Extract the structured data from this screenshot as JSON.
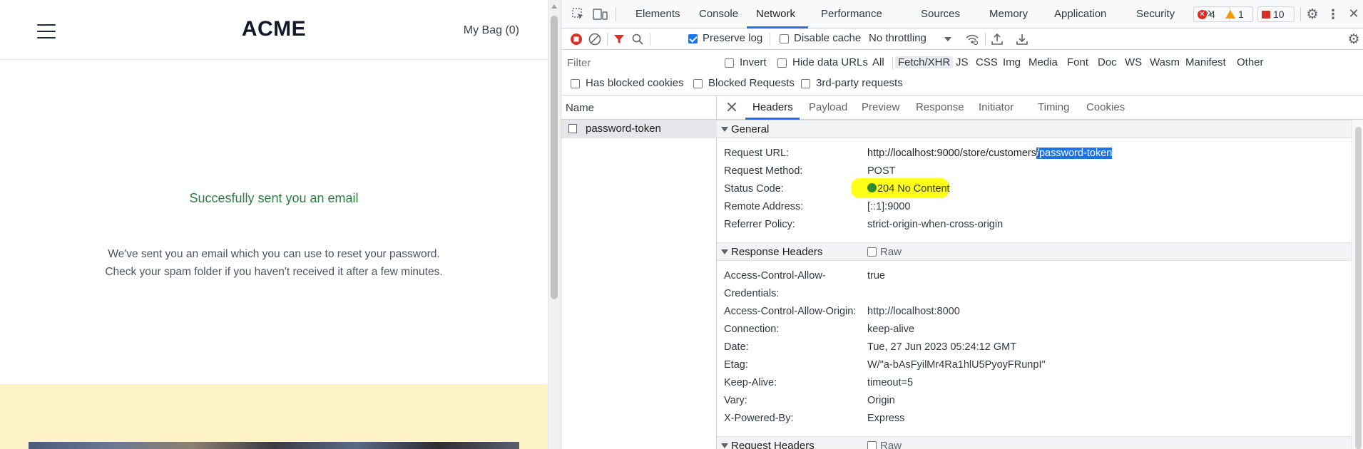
{
  "store": {
    "logo": "ACME",
    "bag_label": "My Bag (0)",
    "success_title": "Succesfully sent you an email",
    "success_body": "We've sent you an email which you can use to reset your password. Check your spam folder if you haven't received it after a few minutes."
  },
  "devtools": {
    "main_tabs": [
      "Elements",
      "Console",
      "Network",
      "Performance",
      "Sources",
      "Memory",
      "Application",
      "Security"
    ],
    "active_main_tab": "Network",
    "more_tabs_glyph": "»",
    "badges": {
      "errors": "4",
      "warnings": "1",
      "issues": "10"
    },
    "toolbar": {
      "preserve_log_label": "Preserve log",
      "preserve_log_checked": true,
      "disable_cache_label": "Disable cache",
      "disable_cache_checked": false,
      "throttling_label": "No throttling"
    },
    "filter": {
      "placeholder": "Filter",
      "invert_label": "Invert",
      "hide_data_urls_label": "Hide data URLs",
      "types": [
        "All",
        "Fetch/XHR",
        "JS",
        "CSS",
        "Img",
        "Media",
        "Font",
        "Doc",
        "WS",
        "Wasm",
        "Manifest",
        "Other"
      ],
      "selected_type": "Fetch/XHR",
      "has_blocked_cookies_label": "Has blocked cookies",
      "blocked_requests_label": "Blocked Requests",
      "third_party_label": "3rd-party requests"
    },
    "request_list": {
      "column_name": "Name",
      "requests": [
        "password-token"
      ]
    },
    "detail": {
      "tabs": [
        "Headers",
        "Payload",
        "Preview",
        "Response",
        "Initiator",
        "Timing",
        "Cookies"
      ],
      "active_tab": "Headers",
      "general_title": "General",
      "general": {
        "request_url_label": "Request URL:",
        "request_url_prefix": "http://localhost:9000/store/customers",
        "request_url_highlight": "/password-token",
        "request_method_label": "Request Method:",
        "request_method": "POST",
        "status_code_label": "Status Code:",
        "status_code": "204 No Content",
        "remote_address_label": "Remote Address:",
        "remote_address": "[::1]:9000",
        "referrer_policy_label": "Referrer Policy:",
        "referrer_policy": "strict-origin-when-cross-origin"
      },
      "response_headers_title": "Response Headers",
      "raw_label": "Raw",
      "response_headers": [
        {
          "key": "Access-Control-Allow-",
          "key2": "Credentials:",
          "value": "true"
        },
        {
          "key": "Access-Control-Allow-Origin:",
          "value": "http://localhost:8000"
        },
        {
          "key": "Connection:",
          "value": "keep-alive"
        },
        {
          "key": "Date:",
          "value": "Tue, 27 Jun 2023 05:24:12 GMT"
        },
        {
          "key": "Etag:",
          "value": "W/\"a-bAsFyilMr4Ra1hlU5PyoyFRunpI\""
        },
        {
          "key": "Keep-Alive:",
          "value": "timeout=5"
        },
        {
          "key": "Vary:",
          "value": "Origin"
        },
        {
          "key": "X-Powered-By:",
          "value": "Express"
        }
      ],
      "request_headers_title": "Request Headers"
    }
  },
  "colors": {
    "accent": "#1a73e8",
    "success_text": "#2e7d46",
    "promo_bg": "#fef3c7",
    "highlighter": "#ffff1a"
  }
}
